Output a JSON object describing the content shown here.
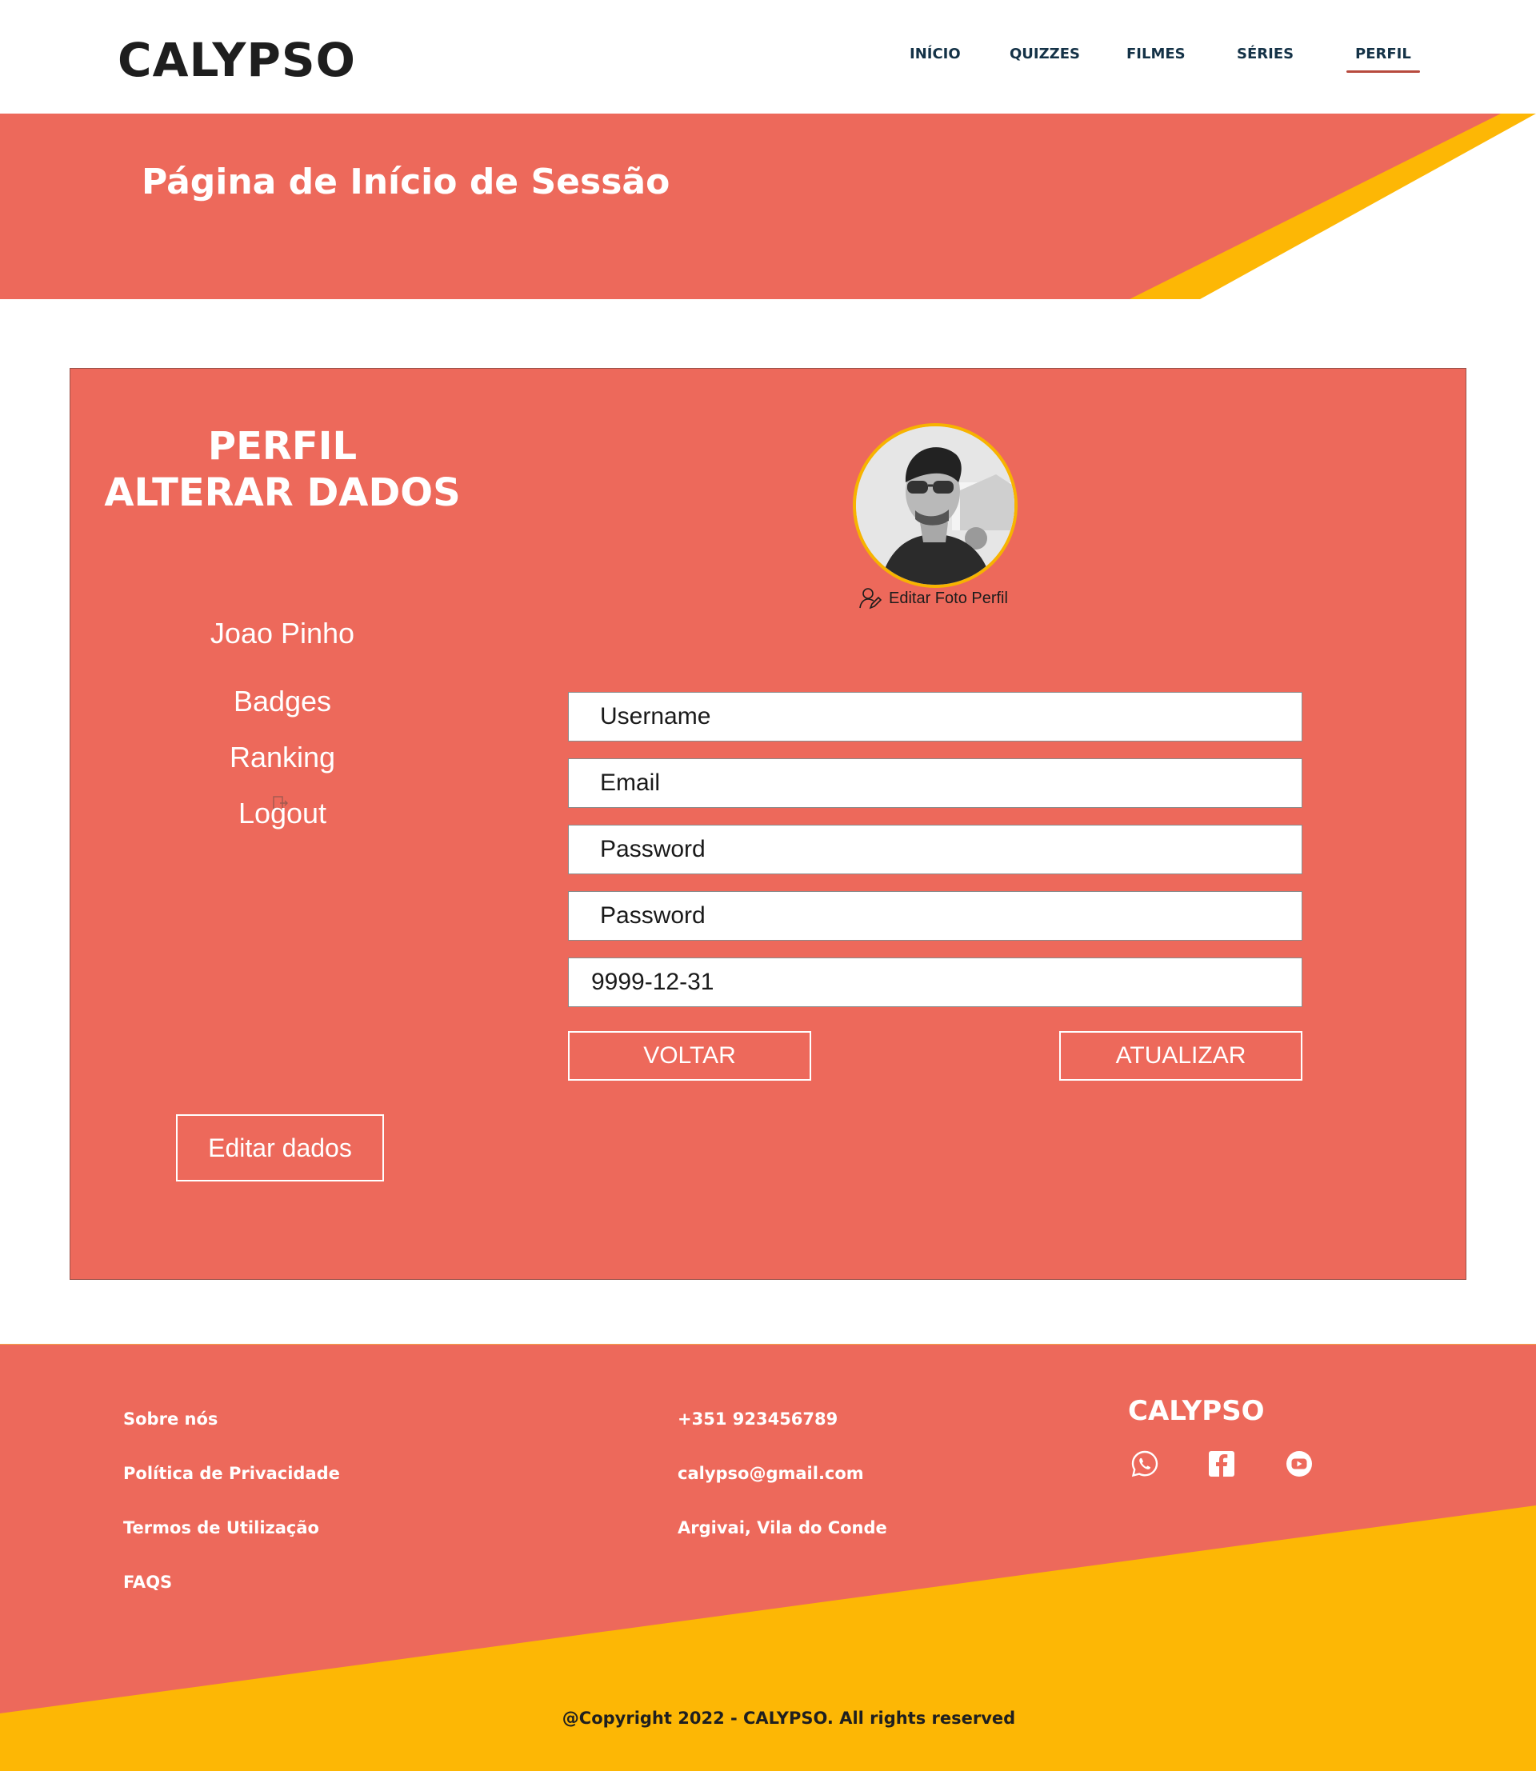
{
  "header": {
    "logo": "CALYPSO",
    "nav": [
      "INÍCIO",
      "QUIZZES",
      "FILMES",
      "SÉRIES",
      "PERFIL"
    ],
    "active_nav": "PERFIL"
  },
  "banner": {
    "title": "Página de Início de Sessão"
  },
  "profile": {
    "heading_line1": "PERFIL",
    "heading_line2": "ALTERAR DADOS",
    "user_name": "Joao Pinho",
    "links": {
      "badges": "Badges",
      "ranking": "Ranking",
      "logout": "Logout"
    },
    "edit_photo_label": "Editar Foto Perfil",
    "edit_data_button": "Editar dados"
  },
  "form": {
    "username": "Username",
    "email": "Email",
    "password": "Password",
    "password_confirm": "Password",
    "date": "9999-12-31",
    "back_button": "VOLTAR",
    "update_button": "ATUALIZAR"
  },
  "footer": {
    "links": [
      "Sobre nós",
      "Política de Privacidade",
      "Termos de Utilização",
      "FAQS"
    ],
    "phone": "+351 923456789",
    "email": "calypso@gmail.com",
    "address": "Argivai, Vila do Conde",
    "brand": "CALYPSO",
    "social_icons": [
      "whatsapp-icon",
      "facebook-icon",
      "youtube-icon"
    ],
    "copyright": "@Copyright 2022 - CALYPSO. All rights reserved"
  },
  "colors": {
    "coral": "#ed695b",
    "yellow": "#fdb705",
    "nav_text": "#143247",
    "logo": "#1e1e1e"
  }
}
